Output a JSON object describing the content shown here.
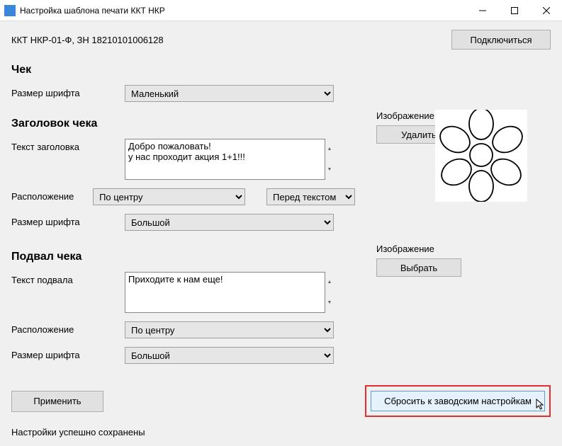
{
  "window": {
    "title": "Настройка шаблона печати ККТ НКР"
  },
  "device": "ККТ НКР-01-Ф, ЗН 18210101006128",
  "buttons": {
    "connect": "Подключиться",
    "delete_img": "Удалить",
    "choose_img": "Выбрать",
    "apply": "Применить",
    "reset": "Сбросить к заводским настройкам"
  },
  "sections": {
    "check": "Чек",
    "header": "Заголовок чека",
    "footer": "Подвал чека"
  },
  "labels": {
    "font_size": "Размер шрифта",
    "header_text": "Текст заголовка",
    "position": "Расположение",
    "footer_text": "Текст подвала",
    "image": "Изображение"
  },
  "values": {
    "check_font": "Маленький",
    "header_text": "Добро пожаловать!\nу нас проходит акция 1+1!!!",
    "header_position": "По центру",
    "header_font": "Большой",
    "image_position": "Перед текстом",
    "footer_text": "Приходите к нам еще!",
    "footer_position": "По центру",
    "footer_font": "Большой"
  },
  "status": "Настройки успешно сохранены"
}
